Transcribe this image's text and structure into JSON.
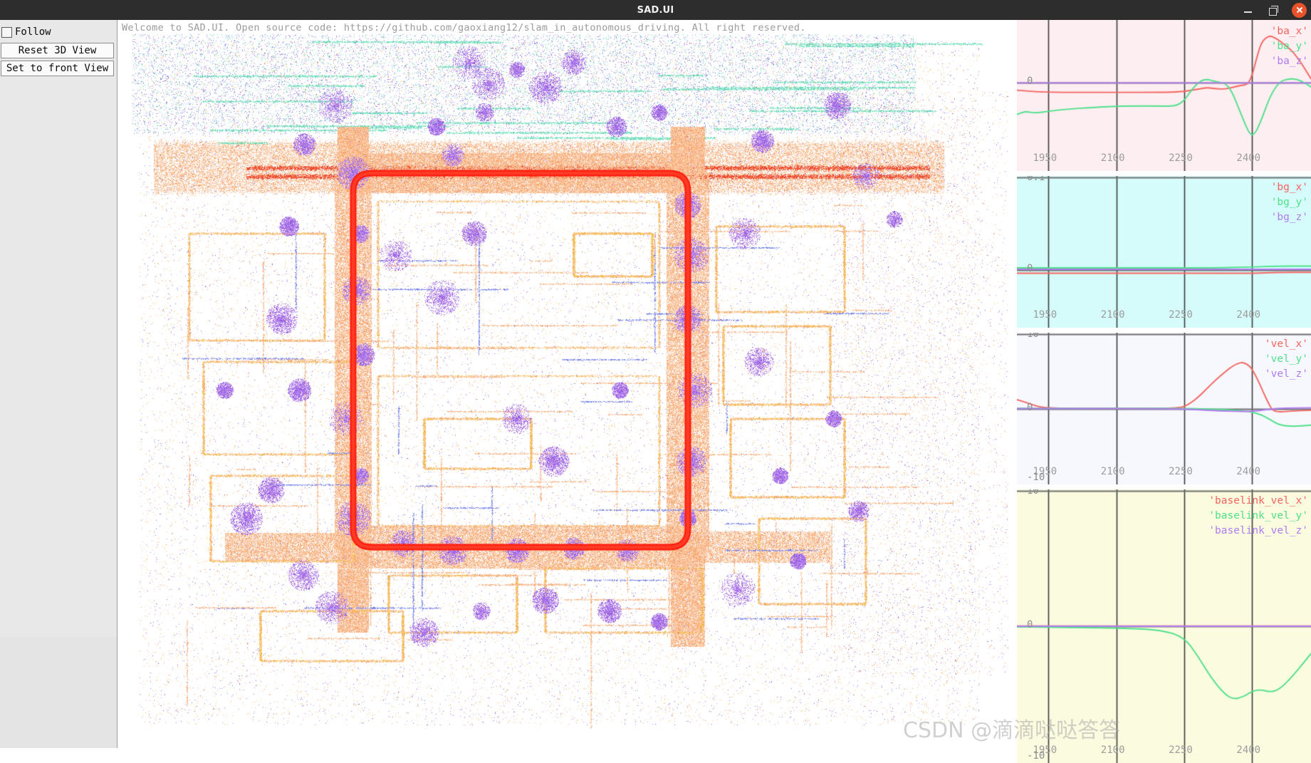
{
  "window": {
    "title": "SAD.UI",
    "controls": {
      "minimize": "minimize",
      "maximize": "maximize",
      "close": "close"
    }
  },
  "sidebar": {
    "follow_checkbox": {
      "label": "Follow",
      "checked": false
    },
    "buttons": [
      {
        "label": "Reset 3D View"
      },
      {
        "label": "Set to front View"
      }
    ]
  },
  "viewport": {
    "welcome_text": "Welcome to SAD.UI. Open source code: https://github.com/gaoxiang12/slam_in_autonomous_driving. All right reserved.",
    "map_description": "lidar point cloud map with red vehicle trajectory loop"
  },
  "watermark": {
    "text": "CSDN @滴滴哒哒答答"
  },
  "chart_data": [
    {
      "type": "line",
      "id": "ba",
      "title": "",
      "background": "#fdeef1",
      "legend": [
        "'ba_x'",
        "'ba_y'",
        "'ba_z'"
      ],
      "legend_position": "top-right",
      "grid": true,
      "xlabel": "",
      "ylabel": "",
      "xticks": [
        1950,
        2100,
        2250,
        2400
      ],
      "yticks": [
        "0"
      ],
      "xlim": [
        1880,
        2530
      ],
      "ylim": [
        -0.42,
        0.3
      ],
      "series": [
        {
          "name": "'ba_x'",
          "color": "#f4645f",
          "x": [
            1880,
            1920,
            1960,
            2000,
            2060,
            2120,
            2180,
            2240,
            2280,
            2300,
            2320,
            2340,
            2360,
            2375,
            2390,
            2400,
            2410,
            2420,
            2430,
            2440,
            2455,
            2470,
            2490,
            2510,
            2530
          ],
          "y": [
            -0.035,
            -0.042,
            -0.045,
            -0.045,
            -0.045,
            -0.045,
            -0.045,
            -0.044,
            -0.03,
            -0.022,
            -0.028,
            -0.03,
            -0.02,
            -0.012,
            -0.008,
            0.035,
            0.12,
            0.19,
            0.215,
            0.225,
            0.21,
            0.185,
            0.15,
            0.09,
            0.02
          ]
        },
        {
          "name": "'ba_y'",
          "color": "#4fe08a",
          "x": [
            1880,
            1900,
            1920,
            1950,
            1990,
            2040,
            2090,
            2140,
            2190,
            2230,
            2250,
            2265,
            2285,
            2300,
            2320,
            2340,
            2355,
            2370,
            2385,
            2395,
            2405,
            2420,
            2440,
            2460,
            2480,
            2500,
            2520,
            2530
          ],
          "y": [
            -0.15,
            -0.135,
            -0.145,
            -0.135,
            -0.125,
            -0.118,
            -0.112,
            -0.11,
            -0.11,
            -0.112,
            -0.085,
            -0.035,
            0.01,
            0.018,
            0.005,
            0.0,
            -0.04,
            -0.12,
            -0.2,
            -0.245,
            -0.248,
            -0.18,
            -0.06,
            0.005,
            0.02,
            0.018,
            -0.005,
            -0.02
          ]
        },
        {
          "name": "'ba_z'",
          "color": "#b07cf0",
          "x": [
            1880,
            2530
          ],
          "y": [
            0.0,
            0.0
          ]
        }
      ]
    },
    {
      "type": "line",
      "id": "bg",
      "title": "",
      "background": "#d6fbfb",
      "legend": [
        "'bg_x'",
        "'bg_y'",
        "'bg_z'"
      ],
      "legend_position": "top-right",
      "grid": true,
      "xlabel": "",
      "ylabel": "",
      "xticks": [
        1950,
        2100,
        2250,
        2400
      ],
      "yticks": [
        "0.1",
        "0"
      ],
      "xlim": [
        1880,
        2530
      ],
      "ylim": [
        -0.065,
        0.105
      ],
      "series": [
        {
          "name": "'bg_x'",
          "color": "#f4645f",
          "x": [
            1880,
            2000,
            2150,
            2300,
            2400,
            2450,
            2530
          ],
          "y": [
            -0.004,
            -0.004,
            -0.004,
            -0.004,
            -0.004,
            -0.003,
            -0.003
          ]
        },
        {
          "name": "'bg_y'",
          "color": "#4fe08a",
          "x": [
            1880,
            2000,
            2150,
            2300,
            2400,
            2450,
            2530
          ],
          "y": [
            0.002,
            0.002,
            0.002,
            0.002,
            0.003,
            0.004,
            0.004
          ]
        },
        {
          "name": "'bg_z'",
          "color": "#b07cf0",
          "x": [
            1880,
            2000,
            2150,
            2300,
            2400,
            2450,
            2530
          ],
          "y": [
            0.0005,
            0.0005,
            0.0005,
            0.0005,
            0.0005,
            0.0005,
            0.0005
          ]
        }
      ]
    },
    {
      "type": "line",
      "id": "vel",
      "title": "",
      "background": "#f7f8fe",
      "legend": [
        "'vel_x'",
        "'vel_y'",
        "'vel_z'"
      ],
      "legend_position": "top-right",
      "grid": true,
      "xlabel": "",
      "ylabel": "",
      "xticks": [
        1950,
        2100,
        2250,
        2400
      ],
      "yticks": [
        "10",
        "0",
        "-10"
      ],
      "xlim": [
        1880,
        2530
      ],
      "ylim": [
        -11,
        11
      ],
      "series": [
        {
          "name": "'vel_x'",
          "color": "#f4645f",
          "x": [
            1880,
            1900,
            1920,
            1940,
            1970,
            2050,
            2150,
            2240,
            2260,
            2280,
            2300,
            2320,
            2340,
            2355,
            2370,
            2380,
            2395,
            2405,
            2415,
            2425,
            2435,
            2445,
            2460,
            2490,
            2530
          ],
          "y": [
            1.3,
            0.9,
            0.4,
            0.15,
            0.05,
            0.03,
            0.02,
            0.05,
            0.6,
            1.6,
            2.9,
            4.2,
            5.3,
            6.1,
            6.6,
            6.7,
            6.2,
            5.1,
            3.8,
            2.3,
            0.9,
            -0.3,
            -0.5,
            -0.35,
            -0.25
          ]
        },
        {
          "name": "'vel_y'",
          "color": "#4fe08a",
          "x": [
            1880,
            2000,
            2150,
            2250,
            2300,
            2360,
            2400,
            2420,
            2440,
            2460,
            2490,
            2530
          ],
          "y": [
            0.02,
            0.02,
            0.02,
            0.02,
            -0.05,
            -0.2,
            -0.5,
            -0.9,
            -1.6,
            -2.4,
            -2.6,
            -2.4
          ]
        },
        {
          "name": "'vel_z'",
          "color": "#b07cf0",
          "x": [
            1880,
            2000,
            2150,
            2250,
            2330,
            2400,
            2450,
            2530
          ],
          "y": [
            0.0,
            0.0,
            0.0,
            -0.05,
            -0.35,
            -0.45,
            0.05,
            0.12
          ]
        }
      ]
    },
    {
      "type": "line",
      "id": "baselink_vel",
      "title": "",
      "background": "#fbfbe0",
      "legend": [
        "'baselink_vel_x'",
        "'baselink_vel_y'",
        "'baselink_vel_z'"
      ],
      "legend_position": "top-right",
      "grid": true,
      "xlabel": "",
      "ylabel": "",
      "xticks": [
        1950,
        2100,
        2250,
        2400
      ],
      "yticks": [
        "10",
        "0",
        "-10"
      ],
      "xlim": [
        1880,
        2530
      ],
      "ylim": [
        -11,
        11
      ],
      "series": [
        {
          "name": "'baselink_vel_x'",
          "color": "#f4645f",
          "x": [
            1880,
            2000,
            2150,
            2250,
            2350,
            2450,
            2530
          ],
          "y": [
            0.02,
            0.02,
            0.02,
            0.02,
            0.02,
            0.02,
            0.02
          ]
        },
        {
          "name": "'baselink_vel_y'",
          "color": "#4fe08a",
          "x": [
            1880,
            2000,
            2120,
            2200,
            2250,
            2280,
            2310,
            2340,
            2360,
            2385,
            2400,
            2420,
            2440,
            2460,
            2490,
            2530
          ],
          "y": [
            -0.05,
            -0.1,
            -0.15,
            -0.3,
            -0.9,
            -2.4,
            -4.2,
            -5.5,
            -5.9,
            -5.6,
            -5.2,
            -5.1,
            -5.3,
            -5.1,
            -4.0,
            -2.2
          ]
        },
        {
          "name": "'baselink_vel_z'",
          "color": "#b07cf0",
          "x": [
            1880,
            2000,
            2150,
            2300,
            2400,
            2450,
            2530
          ],
          "y": [
            0.0,
            0.0,
            0.0,
            0.0,
            0.0,
            0.0,
            0.0
          ]
        }
      ]
    }
  ]
}
